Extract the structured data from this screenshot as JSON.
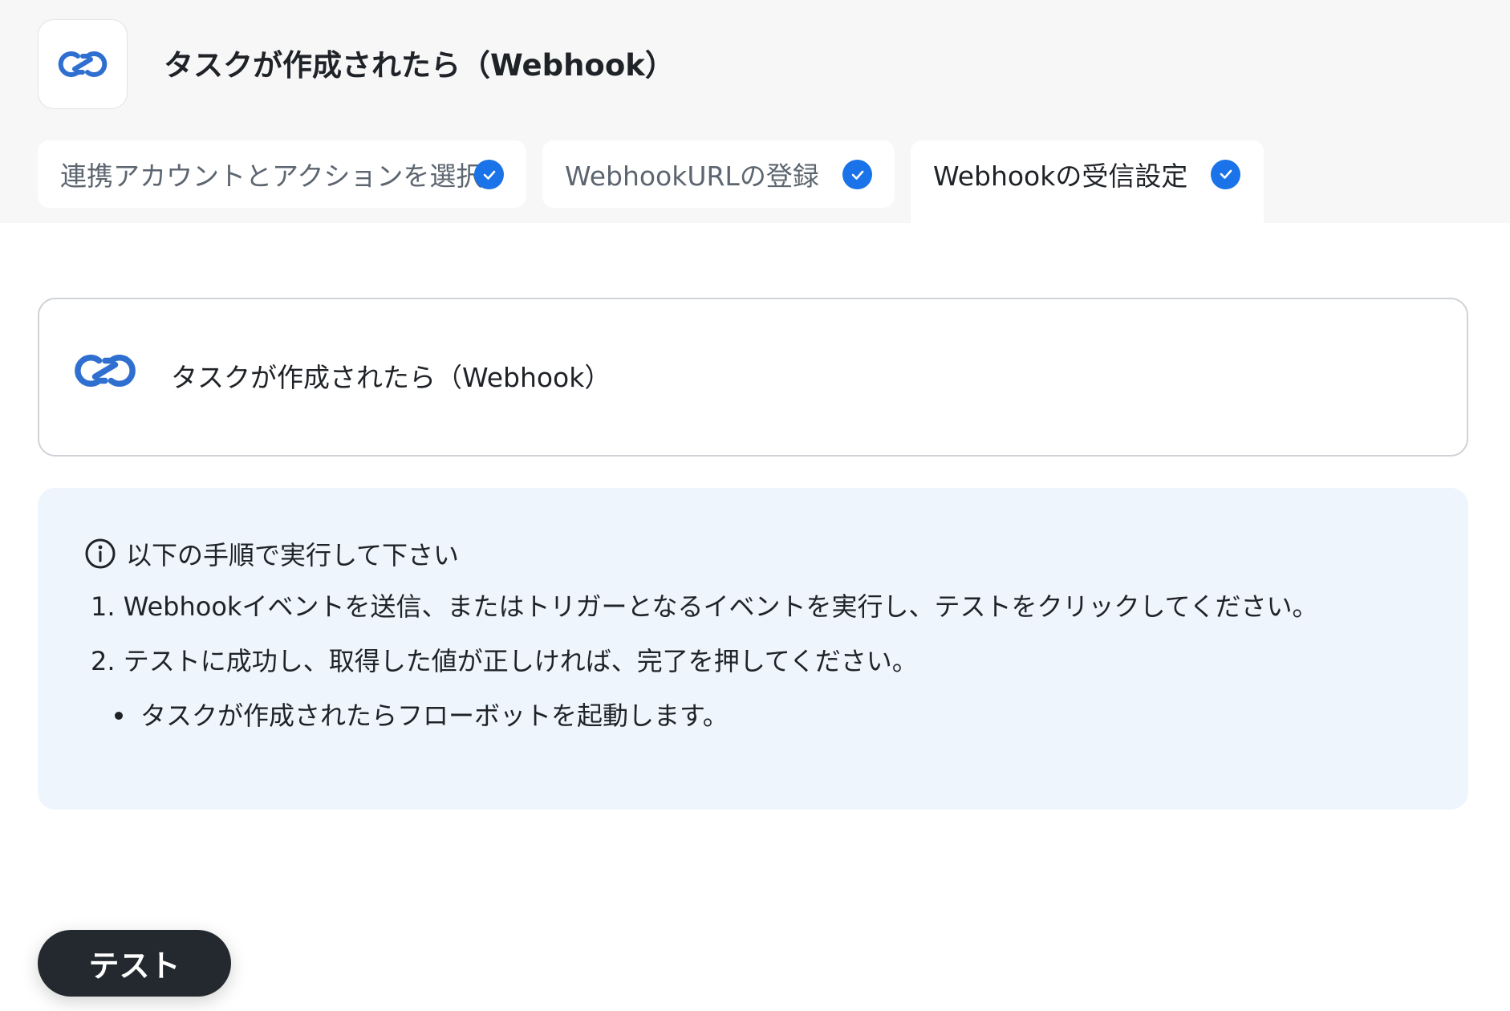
{
  "header": {
    "title": "タスクが作成されたら（Webhook）",
    "app_icon": "zoho-link-icon"
  },
  "tabs": [
    {
      "label": "連携アカウントとアクションを選択",
      "status": "completed",
      "active": false
    },
    {
      "label": "WebhookURLの登録",
      "status": "completed",
      "active": false
    },
    {
      "label": "Webhookの受信設定",
      "status": "completed",
      "active": true
    }
  ],
  "trigger_card": {
    "label": "タスクが作成されたら（Webhook）",
    "icon": "zoho-link-icon"
  },
  "instructions": {
    "heading": "以下の手順で実行して下さい",
    "steps": [
      "1. Webhookイベントを送信、またはトリガーとなるイベントを実行し、テストをクリックしてください。",
      "2. テストに成功し、取得した値が正しければ、完了を押してください。"
    ],
    "notes": [
      "タスクが作成されたらフローボットを起動します。"
    ]
  },
  "actions": {
    "test_label": "テスト"
  },
  "colors": {
    "accent": "#1a73e8",
    "icon_blue": "#2f6fd0",
    "info_bg": "#eef5fd",
    "button_bg": "#24292f"
  }
}
